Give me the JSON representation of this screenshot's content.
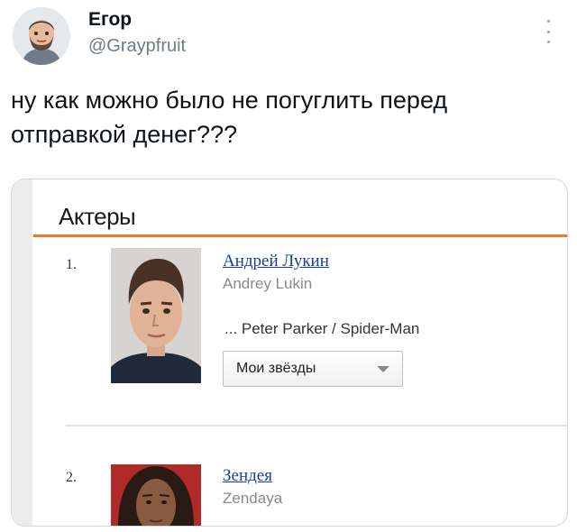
{
  "tweet": {
    "author_name": "Егор",
    "author_handle": "@Graypfruit",
    "text": "ну как можно было не погуглить перед отправкой денег???"
  },
  "screenshot": {
    "section_title": "Актеры",
    "actors": [
      {
        "number": "1.",
        "name": "Андрей Лукин",
        "original_name": "Andrey Lukin",
        "role": "... Peter Parker / Spider-Man",
        "dropdown_label": "Мои звёзды"
      },
      {
        "number": "2.",
        "name": "Зендея",
        "original_name": "Zendaya"
      }
    ]
  },
  "colors": {
    "accent_rule": "#ee7a2a",
    "link": "#1a3f95"
  },
  "icons": {
    "avatar": "cartoon-man-avatar",
    "more": "vertical-dots-icon",
    "dropdown": "triangle-down-icon"
  }
}
